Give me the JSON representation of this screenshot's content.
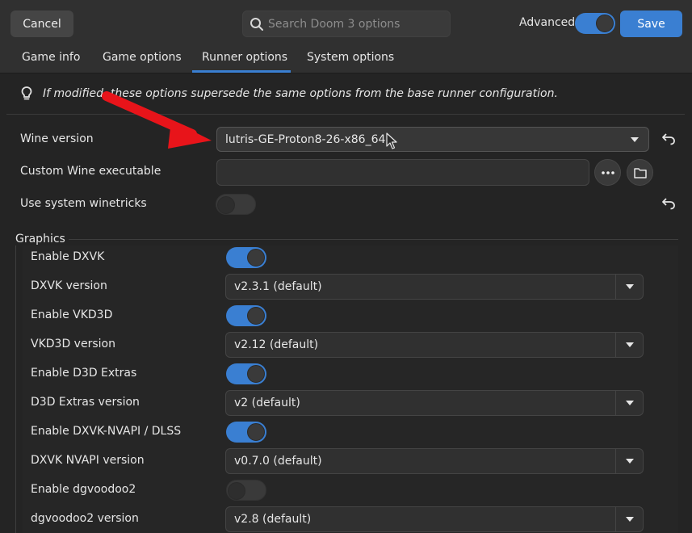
{
  "header": {
    "cancel_label": "Cancel",
    "search_placeholder": "Search Doom 3 options",
    "advanced_label": "Advanced",
    "advanced_on": true,
    "save_label": "Save"
  },
  "tabs": [
    {
      "label": "Game info",
      "active": false
    },
    {
      "label": "Game options",
      "active": false
    },
    {
      "label": "Runner options",
      "active": true
    },
    {
      "label": "System options",
      "active": false
    }
  ],
  "info": {
    "text": "If modified, these options supersede the same options from the base runner configuration."
  },
  "runner": {
    "wine_version_label": "Wine version",
    "wine_version_value": "lutris-GE-Proton8-26-x86_64",
    "custom_wine_label": "Custom Wine executable",
    "custom_wine_value": "",
    "winetricks_label": "Use system winetricks",
    "winetricks_on": false
  },
  "graphics": {
    "title": "Graphics",
    "rows": [
      {
        "label": "Enable DXVK",
        "kind": "toggle",
        "on": true
      },
      {
        "label": "DXVK version",
        "kind": "combo",
        "value": "v2.3.1 (default)"
      },
      {
        "label": "Enable VKD3D",
        "kind": "toggle",
        "on": true
      },
      {
        "label": "VKD3D version",
        "kind": "combo",
        "value": "v2.12 (default)"
      },
      {
        "label": "Enable D3D Extras",
        "kind": "toggle",
        "on": true
      },
      {
        "label": "D3D Extras version",
        "kind": "combo",
        "value": "v2 (default)"
      },
      {
        "label": "Enable DXVK-NVAPI / DLSS",
        "kind": "toggle",
        "on": true
      },
      {
        "label": "DXVK NVAPI version",
        "kind": "combo",
        "value": "v0.7.0 (default)"
      },
      {
        "label": "Enable dgvoodoo2",
        "kind": "toggle",
        "on": false
      },
      {
        "label": "dgvoodoo2 version",
        "kind": "combo",
        "value": "v2.8 (default)"
      }
    ]
  },
  "colors": {
    "accent": "#3a7fd2",
    "annotation_arrow": "#e8141a"
  },
  "icons": {
    "search": "search-icon",
    "info": "lightbulb-icon",
    "reset": "undo-icon",
    "more": "ellipsis-icon",
    "folder": "folder-icon",
    "dropdown": "chevron-down-icon",
    "cursor": "mouse-pointer-icon"
  }
}
